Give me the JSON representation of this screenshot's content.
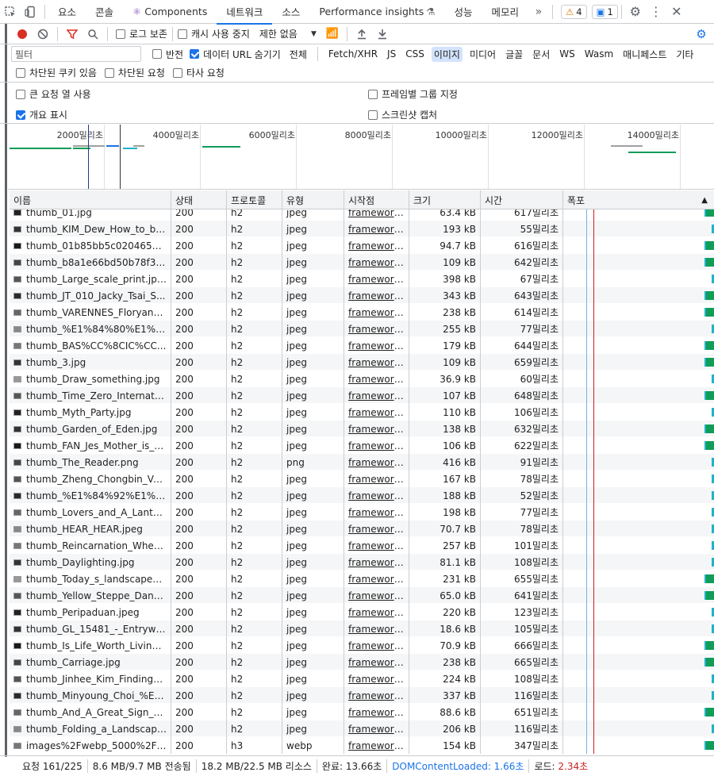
{
  "tabs": [
    "요소",
    "콘솔",
    "Components",
    "네트워크",
    "소스",
    "Performance insights",
    "성능",
    "메모리"
  ],
  "active_tab": "네트워크",
  "warnings": "4",
  "messages": "1",
  "toolbar": {
    "preserve_log": "로그 보존",
    "disable_cache": "캐시 사용 중지",
    "throttle": "제한 없음"
  },
  "filter": {
    "placeholder": "필터",
    "invert": "반전",
    "hide_data_urls": "데이터 URL 숨기기",
    "types": [
      "전체",
      "Fetch/XHR",
      "JS",
      "CSS",
      "이미지",
      "미디어",
      "글꼴",
      "문서",
      "WS",
      "Wasm",
      "매니페스트",
      "기타"
    ],
    "active_type": "이미지"
  },
  "filter2": {
    "blocked_cookies": "차단된 쿠키 있음",
    "blocked_requests": "차단된 요청",
    "third_party": "타사 요청"
  },
  "settings": {
    "big_rows": "큰 요청 열 사용",
    "group_by_frame": "프레임별 그룹 지정",
    "overview": "개요 표시",
    "screenshots": "스크린샷 캡처"
  },
  "overview_ticks": [
    "2000밀리초",
    "4000밀리초",
    "6000밀리초",
    "8000밀리초",
    "10000밀리초",
    "12000밀리초",
    "14000밀리초"
  ],
  "columns": [
    "이름",
    "상태",
    "프로토콜",
    "유형",
    "시작점",
    "크기",
    "시간",
    "폭포"
  ],
  "rows": [
    [
      "thumb_01.jpg",
      "200",
      "h2",
      "jpeg",
      "framework-...",
      "63.4 kB",
      "617밀리초"
    ],
    [
      "thumb_KIM_Dew_How_to_be...",
      "200",
      "h2",
      "jpeg",
      "framework-...",
      "193 kB",
      "55밀리초"
    ],
    [
      "thumb_01b85bb5c020465292...",
      "200",
      "h2",
      "jpeg",
      "framework-...",
      "94.7 kB",
      "616밀리초"
    ],
    [
      "thumb_b8a1e66bd50b78f3e8...",
      "200",
      "h2",
      "jpeg",
      "framework-...",
      "109 kB",
      "642밀리초"
    ],
    [
      "thumb_Large_scale_print.jpeg",
      "200",
      "h2",
      "jpeg",
      "framework-...",
      "398 kB",
      "67밀리초"
    ],
    [
      "thumb_JT_010_Jacky_Tsai_S...",
      "200",
      "h2",
      "jpeg",
      "framework-...",
      "343 kB",
      "643밀리초"
    ],
    [
      "thumb_VARENNES_Floryan_L...",
      "200",
      "h2",
      "jpeg",
      "framework-...",
      "238 kB",
      "614밀리초"
    ],
    [
      "thumb_%E1%84%80%E1%8...",
      "200",
      "h2",
      "jpeg",
      "framework-...",
      "255 kB",
      "77밀리초"
    ],
    [
      "thumb_BAS%CC%8CIC%CC...",
      "200",
      "h2",
      "jpeg",
      "framework-...",
      "179 kB",
      "644밀리초"
    ],
    [
      "thumb_3.jpg",
      "200",
      "h2",
      "jpeg",
      "framework-...",
      "109 kB",
      "659밀리초"
    ],
    [
      "thumb_Draw_something.jpg",
      "200",
      "h2",
      "jpeg",
      "framework-...",
      "36.9 kB",
      "60밀리초"
    ],
    [
      "thumb_Time_Zero_Internation...",
      "200",
      "h2",
      "jpeg",
      "framework-...",
      "107 kB",
      "648밀리초"
    ],
    [
      "thumb_Myth_Party.jpg",
      "200",
      "h2",
      "jpeg",
      "framework-...",
      "110 kB",
      "106밀리초"
    ],
    [
      "thumb_Garden_of_Eden.jpg",
      "200",
      "h2",
      "jpeg",
      "framework-...",
      "138 kB",
      "632밀리초"
    ],
    [
      "thumb_FAN_Jes_Mother_is_a...",
      "200",
      "h2",
      "jpeg",
      "framework-...",
      "106 kB",
      "622밀리초"
    ],
    [
      "thumb_The_Reader.png",
      "200",
      "h2",
      "png",
      "framework-...",
      "416 kB",
      "91밀리초"
    ],
    [
      "thumb_Zheng_Chongbin_Vec...",
      "200",
      "h2",
      "jpeg",
      "framework-...",
      "167 kB",
      "78밀리초"
    ],
    [
      "thumb_%E1%84%92%E1%8...",
      "200",
      "h2",
      "jpeg",
      "framework-...",
      "188 kB",
      "52밀리초"
    ],
    [
      "thumb_Lovers_and_A_Lanter...",
      "200",
      "h2",
      "jpeg",
      "framework-...",
      "198 kB",
      "77밀리초"
    ],
    [
      "thumb_HEAR_HEAR.jpeg",
      "200",
      "h2",
      "jpeg",
      "framework-...",
      "70.7 kB",
      "78밀리초"
    ],
    [
      "thumb_Reincarnation_Wheel_...",
      "200",
      "h2",
      "jpeg",
      "framework-...",
      "257 kB",
      "101밀리초"
    ],
    [
      "thumb_Daylighting.jpg",
      "200",
      "h2",
      "jpeg",
      "framework-...",
      "81.1 kB",
      "108밀리초"
    ],
    [
      "thumb_Today_s_landscape__...",
      "200",
      "h2",
      "jpeg",
      "framework-...",
      "231 kB",
      "655밀리초"
    ],
    [
      "thumb_Yellow_Steppe_Dange...",
      "200",
      "h2",
      "jpeg",
      "framework-...",
      "65.0 kB",
      "641밀리초"
    ],
    [
      "thumb_Peripaduan.jpeg",
      "200",
      "h2",
      "jpeg",
      "framework-...",
      "220 kB",
      "123밀리초"
    ],
    [
      "thumb_GL_15481_-_Entryway...",
      "200",
      "h2",
      "jpeg",
      "framework-...",
      "18.6 kB",
      "105밀리초"
    ],
    [
      "thumb_Is_Life_Worth_Living.jpg",
      "200",
      "h2",
      "jpeg",
      "framework-...",
      "70.9 kB",
      "666밀리초"
    ],
    [
      "thumb_Carriage.jpg",
      "200",
      "h2",
      "jpeg",
      "framework-...",
      "238 kB",
      "665밀리초"
    ],
    [
      "thumb_Jinhee_Kim_Finding_S...",
      "200",
      "h2",
      "jpeg",
      "framework-...",
      "224 kB",
      "108밀리초"
    ],
    [
      "thumb_Minyoung_Choi_%E1...",
      "200",
      "h2",
      "jpeg",
      "framework-...",
      "337 kB",
      "116밀리초"
    ],
    [
      "thumb_And_A_Great_Sign_A...",
      "200",
      "h2",
      "jpeg",
      "framework-...",
      "88.6 kB",
      "651밀리초"
    ],
    [
      "thumb_Folding_a_Landscape....",
      "200",
      "h2",
      "jpeg",
      "framework-...",
      "206 kB",
      "116밀리초"
    ],
    [
      "images%2Fwebp_5000%2Fc...",
      "200",
      "h3",
      "webp",
      "framework-...",
      "154 kB",
      "347밀리초"
    ]
  ],
  "status": {
    "requests": "요청 161/225",
    "transferred": "8.6 MB/9.7 MB 전송됨",
    "resources": "18.2 MB/22.5 MB 리소스",
    "finish": "완료: 13.66초",
    "dcl": "DOMContentLoaded: 1.66초",
    "load_label": "로드: ",
    "load_value": "2.34초"
  },
  "colors": {
    "accent": "#1a73e8",
    "load_line": "#c5221f",
    "dcl_line": "#1a73e8",
    "waterfall_green": "#0f9d58"
  }
}
